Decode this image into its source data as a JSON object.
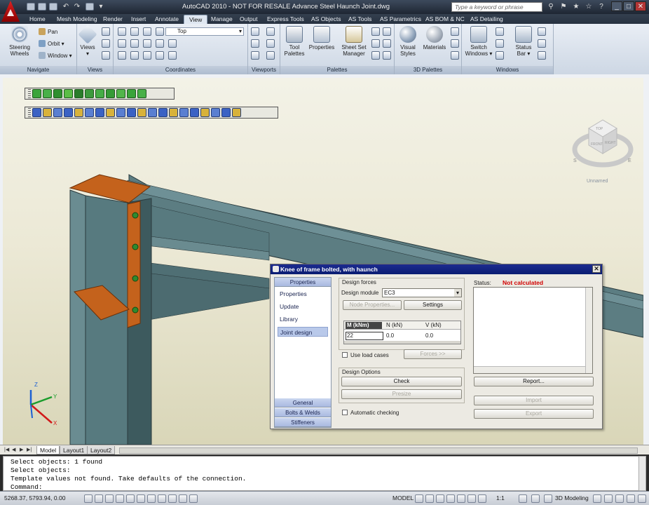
{
  "titlebar": {
    "title": "AutoCAD 2010 - NOT FOR RESALE    Advance Steel Haunch Joint.dwg",
    "search_placeholder": "Type a keyword or phrase"
  },
  "tabs": [
    "Home",
    "Mesh Modeling",
    "Render",
    "Insert",
    "Annotate",
    "View",
    "Manage",
    "Output",
    "Express Tools",
    "AS Objects",
    "AS Tools",
    "AS Parametrics",
    "AS BOM & NC",
    "AS Detailing"
  ],
  "ribbon": {
    "navigate": {
      "title": "Navigate",
      "steering": "Steering\nWheels",
      "pan": "Pan",
      "orbit": "Orbit",
      "window": "Window"
    },
    "views": {
      "title": "Views",
      "label": "Views"
    },
    "coordinates": {
      "title": "Coordinates",
      "combo": "Top"
    },
    "viewports": {
      "title": "Viewports"
    },
    "palettes": {
      "title": "Palettes",
      "tool": "Tool\nPalettes",
      "properties": "Properties",
      "sheetset": "Sheet Set\nManager"
    },
    "palettes3d": {
      "title": "3D Palettes",
      "visual": "Visual\nStyles",
      "materials": "Materials"
    },
    "windows": {
      "title": "Windows",
      "switch": "Switch\nWindows",
      "statusbar": "Status\nBar"
    }
  },
  "viewcube": {
    "top": "TOP",
    "front": "FRONT",
    "right": "RIGHT",
    "s": "S",
    "e": "E",
    "preset": "Unnamed"
  },
  "dialog": {
    "title": "Knee of frame bolted, with haunch",
    "nav_header": "Properties",
    "nav_items": [
      "Properties",
      "Update",
      "Library",
      "Joint design"
    ],
    "nav_footer": [
      "General",
      "Bolts & Welds",
      "Stiffeners"
    ],
    "design_forces": "Design forces",
    "design_module_label": "Design module",
    "design_module_value": "EC3",
    "node_properties": "Node Properties...",
    "settings": "Settings",
    "table_headers": [
      "M (kNm)",
      "N (kN)",
      "V (kN)"
    ],
    "table_values": [
      "22",
      "0.0",
      "0.0"
    ],
    "use_load_cases": "Use load cases",
    "forces_btn": "Forces >>",
    "design_options": "Design Options",
    "check": "Check",
    "presize": "Presize",
    "automatic_checking": "Automatic checking",
    "status_label": "Status:",
    "status_value": "Not calculated",
    "report": "Report...",
    "import": "Import",
    "export": "Export"
  },
  "layout_tabs": [
    "Model",
    "Layout1",
    "Layout2"
  ],
  "command_lines": [
    "Select objects: 1 found",
    "Select objects:",
    "Template values not found. Take defaults of the connection.",
    "Command:"
  ],
  "statusbar": {
    "coords": "5268.37, 5793.94, 0.00",
    "model": "MODEL",
    "scale": "1:1",
    "workspace": "3D Modeling"
  },
  "axes": {
    "x": "X",
    "y": "Y",
    "z": "Z"
  },
  "colors": {
    "accent": "#0b1f7a",
    "steel_body": "#4f6f74",
    "plate": "#c4621c",
    "status_red": "#d00000"
  }
}
